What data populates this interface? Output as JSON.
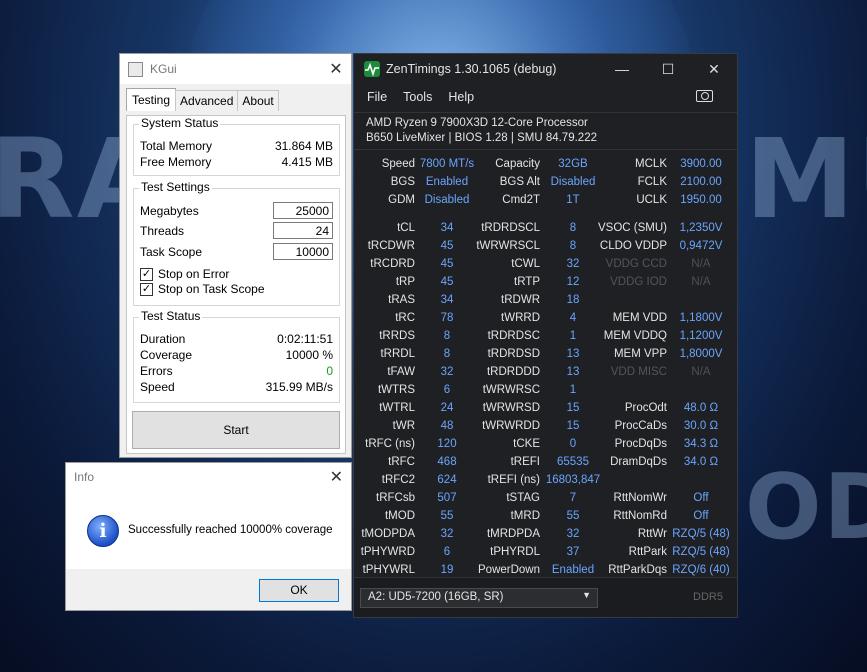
{
  "wallpaper": {
    "texts": [
      "RAU",
      "MU",
      "ODE"
    ]
  },
  "kgui": {
    "title": "KGui",
    "tabs": [
      "Testing",
      "Advanced",
      "About"
    ],
    "system_status": {
      "title": "System Status",
      "rows": [
        {
          "label": "Total Memory",
          "value": "31.864 MB"
        },
        {
          "label": "Free Memory",
          "value": "4.415 MB"
        }
      ]
    },
    "test_settings": {
      "title": "Test Settings",
      "fields": [
        {
          "label": "Megabytes",
          "value": "25000"
        },
        {
          "label": "Threads",
          "value": "24"
        },
        {
          "label": "Task Scope",
          "value": "10000"
        }
      ],
      "checkboxes": [
        {
          "label": "Stop on Error",
          "checked": true
        },
        {
          "label": "Stop on Task Scope",
          "checked": true
        }
      ]
    },
    "test_status": {
      "title": "Test Status",
      "rows": [
        {
          "label": "Duration",
          "value": "0:02:11:51"
        },
        {
          "label": "Coverage",
          "value": "10000 %"
        },
        {
          "label": "Errors",
          "value": "0"
        },
        {
          "label": "Speed",
          "value": "315.99 MB/s"
        }
      ]
    },
    "start_label": "Start"
  },
  "info_dialog": {
    "title": "Info",
    "message": "Successfully reached 10000% coverage",
    "ok_label": "OK"
  },
  "zen": {
    "title": "ZenTimings 1.30.1065 (debug)",
    "menu": [
      "File",
      "Tools",
      "Help"
    ],
    "cpu": "AMD Ryzen 9 7900X3D 12-Core Processor",
    "board": "B650 LiveMixer | BIOS 1.28 | SMU 84.79.222",
    "top_rows": [
      [
        [
          "Speed",
          "7800 MT/s"
        ],
        [
          "Capacity",
          "32GB"
        ],
        [
          "MCLK",
          "3900.00"
        ]
      ],
      [
        [
          "BGS",
          "Enabled"
        ],
        [
          "BGS Alt",
          "Disabled"
        ],
        [
          "FCLK",
          "2100.00"
        ]
      ],
      [
        [
          "GDM",
          "Disabled"
        ],
        [
          "Cmd2T",
          "1T"
        ],
        [
          "UCLK",
          "1950.00"
        ]
      ]
    ],
    "rows": [
      [
        [
          "tCL",
          "34"
        ],
        [
          "tRDRDSCL",
          "8"
        ],
        [
          "VSOC (SMU)",
          "1,2350V"
        ]
      ],
      [
        [
          "tRCDWR",
          "45"
        ],
        [
          "tWRWRSCL",
          "8"
        ],
        [
          "CLDO VDDP",
          "0,9472V"
        ]
      ],
      [
        [
          "tRCDRD",
          "45"
        ],
        [
          "tCWL",
          "32"
        ],
        [
          "VDDG CCD",
          "N/A"
        ]
      ],
      [
        [
          "tRP",
          "45"
        ],
        [
          "tRTP",
          "12"
        ],
        [
          "VDDG IOD",
          "N/A"
        ]
      ],
      [
        [
          "tRAS",
          "34"
        ],
        [
          "tRDWR",
          "18"
        ],
        [
          "",
          ""
        ]
      ],
      [
        [
          "tRC",
          "78"
        ],
        [
          "tWRRD",
          "4"
        ],
        [
          "MEM VDD",
          "1,1800V"
        ]
      ],
      [
        [
          "tRRDS",
          "8"
        ],
        [
          "tRDRDSC",
          "1"
        ],
        [
          "MEM VDDQ",
          "1,1200V"
        ]
      ],
      [
        [
          "tRRDL",
          "8"
        ],
        [
          "tRDRDSD",
          "13"
        ],
        [
          "MEM VPP",
          "1,8000V"
        ]
      ],
      [
        [
          "tFAW",
          "32"
        ],
        [
          "tRDRDDD",
          "13"
        ],
        [
          "VDD MISC",
          "N/A"
        ]
      ],
      [
        [
          "tWTRS",
          "6"
        ],
        [
          "tWRWRSC",
          "1"
        ],
        [
          "",
          ""
        ]
      ],
      [
        [
          "tWTRL",
          "24"
        ],
        [
          "tWRWRSD",
          "15"
        ],
        [
          "ProcOdt",
          "48.0 Ω"
        ]
      ],
      [
        [
          "tWR",
          "48"
        ],
        [
          "tWRWRDD",
          "15"
        ],
        [
          "ProcCaDs",
          "30.0 Ω"
        ]
      ],
      [
        [
          "tRFC (ns)",
          "120"
        ],
        [
          "tCKE",
          "0"
        ],
        [
          "ProcDqDs",
          "34.3 Ω"
        ]
      ],
      [
        [
          "tRFC",
          "468"
        ],
        [
          "tREFI",
          "65535"
        ],
        [
          "DramDqDs",
          "34.0 Ω"
        ]
      ],
      [
        [
          "tRFC2",
          "624"
        ],
        [
          "tREFI (ns)",
          "16803,847"
        ],
        [
          "",
          ""
        ]
      ],
      [
        [
          "tRFCsb",
          "507"
        ],
        [
          "tSTAG",
          "7"
        ],
        [
          "RttNomWr",
          "Off"
        ]
      ],
      [
        [
          "tMOD",
          "55"
        ],
        [
          "tMRD",
          "55"
        ],
        [
          "RttNomRd",
          "Off"
        ]
      ],
      [
        [
          "tMODPDA",
          "32"
        ],
        [
          "tMRDPDA",
          "32"
        ],
        [
          "RttWr",
          "RZQ/5 (48)"
        ]
      ],
      [
        [
          "tPHYWRD",
          "6"
        ],
        [
          "tPHYRDL",
          "37"
        ],
        [
          "RttPark",
          "RZQ/5 (48)"
        ]
      ],
      [
        [
          "tPHYWRL",
          "19"
        ],
        [
          "PowerDown",
          "Enabled"
        ],
        [
          "RttParkDqs",
          "RZQ/6 (40)"
        ]
      ]
    ],
    "disabled_items": [
      "VDDG CCD",
      "VDDG IOD",
      "VDD MISC"
    ],
    "dimm_select": "A2: UD5-7200 (16GB, SR)",
    "ddr_label": "DDR5"
  }
}
